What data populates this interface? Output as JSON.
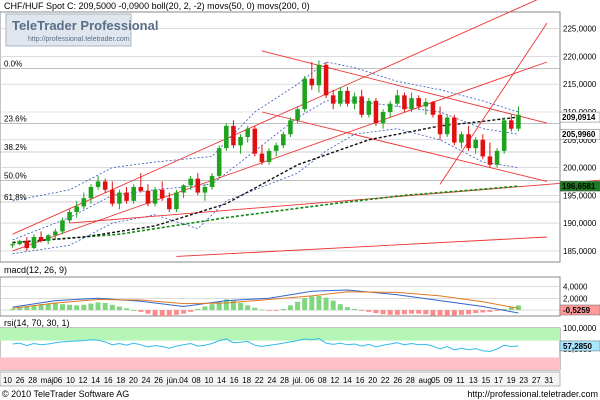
{
  "chart_data": [
    {
      "type": "candlestick",
      "title": "CHF/HUF Spot C: 209,5000 -0,0900 boll(20, 2, -2) movs(50, 0) movs(200, 0)",
      "watermark": {
        "brand": "TeleTrader Professional",
        "url": "http://professional.teletrader.com"
      },
      "ylim": [
        183,
        228
      ],
      "y_ticks": [
        "185,0000",
        "190,0000",
        "195,0000",
        "200,0000",
        "205,0000",
        "210,0000",
        "215,0000",
        "220,0000",
        "225,0000"
      ],
      "fib_levels": [
        {
          "label": "0.0%",
          "y": 217.8
        },
        {
          "label": "23.6%",
          "y": 207.9
        },
        {
          "label": "38.2%",
          "y": 202.8
        },
        {
          "label": "50.0%",
          "y": 197.7
        },
        {
          "label": "61.8%",
          "y": 193.8
        }
      ],
      "value_labels": [
        {
          "text": "209,0914",
          "y": 209.09,
          "color": "#cc0000",
          "bg": "#ffffff"
        },
        {
          "text": "205,9960",
          "y": 206.0,
          "color": "#000000",
          "bg": "#ffffff"
        },
        {
          "text": "196,6581",
          "y": 196.66,
          "color": "#ffffff",
          "bg": "#1f7a1f"
        }
      ],
      "candles": [
        [
          186.0,
          186.5,
          185.5,
          186.2
        ],
        [
          186.2,
          187.0,
          186.0,
          186.8
        ],
        [
          186.8,
          187.5,
          185.0,
          185.5
        ],
        [
          185.5,
          188.0,
          185.3,
          187.5
        ],
        [
          187.5,
          188.5,
          186.5,
          186.8
        ],
        [
          186.8,
          188.0,
          186.2,
          187.8
        ],
        [
          187.8,
          189.0,
          187.0,
          188.5
        ],
        [
          188.5,
          191.0,
          188.0,
          190.5
        ],
        [
          190.5,
          192.5,
          190.0,
          192.0
        ],
        [
          192.0,
          194.0,
          191.0,
          193.0
        ],
        [
          193.0,
          195.5,
          192.5,
          194.5
        ],
        [
          194.5,
          197.0,
          193.5,
          196.5
        ],
        [
          196.5,
          198.5,
          196.0,
          197.5
        ],
        [
          197.5,
          198.0,
          195.5,
          196.0
        ],
        [
          196.0,
          197.5,
          193.0,
          193.5
        ],
        [
          193.5,
          196.0,
          192.5,
          195.5
        ],
        [
          195.5,
          196.5,
          193.5,
          194.0
        ],
        [
          194.0,
          197.0,
          193.5,
          196.5
        ],
        [
          196.5,
          199.0,
          195.5,
          195.8
        ],
        [
          195.8,
          197.0,
          193.0,
          193.5
        ],
        [
          193.5,
          196.5,
          193.0,
          196.0
        ],
        [
          196.0,
          197.5,
          194.0,
          194.5
        ],
        [
          194.5,
          195.5,
          192.0,
          192.5
        ],
        [
          192.5,
          196.0,
          192.0,
          195.5
        ],
        [
          195.5,
          197.0,
          194.5,
          196.8
        ],
        [
          196.8,
          198.5,
          196.0,
          198.0
        ],
        [
          198.0,
          199.0,
          195.0,
          195.5
        ],
        [
          195.5,
          197.0,
          194.0,
          196.5
        ],
        [
          196.5,
          199.0,
          196.0,
          198.5
        ],
        [
          198.5,
          204.0,
          198.0,
          203.5
        ],
        [
          203.5,
          208.0,
          203.0,
          207.5
        ],
        [
          207.5,
          208.5,
          203.5,
          204.0
        ],
        [
          204.0,
          206.0,
          202.5,
          205.5
        ],
        [
          205.5,
          207.5,
          204.5,
          207.0
        ],
        [
          207.0,
          207.5,
          202.0,
          202.5
        ],
        [
          202.5,
          204.0,
          200.5,
          201.0
        ],
        [
          201.0,
          203.5,
          200.5,
          203.0
        ],
        [
          203.0,
          204.5,
          202.0,
          204.0
        ],
        [
          204.0,
          206.5,
          203.5,
          206.0
        ],
        [
          206.0,
          209.0,
          205.5,
          208.5
        ],
        [
          208.5,
          211.0,
          208.0,
          210.5
        ],
        [
          210.5,
          216.5,
          210.0,
          216.0
        ],
        [
          216.0,
          219.0,
          214.0,
          214.8
        ],
        [
          214.8,
          219.3,
          213.5,
          218.5
        ],
        [
          218.5,
          219.0,
          212.5,
          213.0
        ],
        [
          213.0,
          214.0,
          210.5,
          211.5
        ],
        [
          211.5,
          214.5,
          211.0,
          213.8
        ],
        [
          213.8,
          214.5,
          211.0,
          211.5
        ],
        [
          211.5,
          213.5,
          210.5,
          212.8
        ],
        [
          212.8,
          214.0,
          209.0,
          209.5
        ],
        [
          209.5,
          212.5,
          209.0,
          212.0
        ],
        [
          212.0,
          212.5,
          207.5,
          208.0
        ],
        [
          208.0,
          210.5,
          207.0,
          210.0
        ],
        [
          210.0,
          212.0,
          209.0,
          211.5
        ],
        [
          211.5,
          214.0,
          211.0,
          213.0
        ],
        [
          213.0,
          213.5,
          210.0,
          210.5
        ],
        [
          210.5,
          213.5,
          210.0,
          212.5
        ],
        [
          212.5,
          213.0,
          210.5,
          211.0
        ],
        [
          211.0,
          212.5,
          209.5,
          211.8
        ],
        [
          211.8,
          212.0,
          209.0,
          209.5
        ],
        [
          209.5,
          211.0,
          205.0,
          206.0
        ],
        [
          206.0,
          209.5,
          205.5,
          209.0
        ],
        [
          209.0,
          209.5,
          204.0,
          204.5
        ],
        [
          204.5,
          206.5,
          203.5,
          206.0
        ],
        [
          206.0,
          207.5,
          203.0,
          203.5
        ],
        [
          203.5,
          205.5,
          202.5,
          205.0
        ],
        [
          205.0,
          206.0,
          201.5,
          202.0
        ],
        [
          202.0,
          204.5,
          200.0,
          200.5
        ],
        [
          200.5,
          203.5,
          200.0,
          203.0
        ],
        [
          203.0,
          209.0,
          202.5,
          208.5
        ],
        [
          208.5,
          209.5,
          206.5,
          207.0
        ],
        [
          207.0,
          211.0,
          206.5,
          209.5
        ]
      ],
      "bollinger": {
        "upper": [
          [
            0,
            194
          ],
          [
            8,
            196
          ],
          [
            14,
            200
          ],
          [
            20,
            201
          ],
          [
            28,
            202
          ],
          [
            34,
            210
          ],
          [
            40,
            215
          ],
          [
            44,
            219
          ],
          [
            48,
            218
          ],
          [
            54,
            215.5
          ],
          [
            60,
            214
          ],
          [
            66,
            212
          ],
          [
            71,
            210
          ]
        ],
        "middle": [
          [
            0,
            187
          ],
          [
            8,
            191
          ],
          [
            14,
            195
          ],
          [
            20,
            196
          ],
          [
            28,
            197
          ],
          [
            34,
            203
          ],
          [
            40,
            209
          ],
          [
            44,
            212
          ],
          [
            48,
            212
          ],
          [
            54,
            211
          ],
          [
            60,
            210
          ],
          [
            66,
            207
          ],
          [
            71,
            206
          ]
        ],
        "lower": [
          [
            0,
            184.5
          ],
          [
            8,
            186
          ],
          [
            14,
            190
          ],
          [
            20,
            191.5
          ],
          [
            26,
            189
          ],
          [
            30,
            194
          ],
          [
            36,
            197
          ],
          [
            40,
            199
          ],
          [
            44,
            203
          ],
          [
            48,
            206
          ],
          [
            54,
            207
          ],
          [
            60,
            205
          ],
          [
            66,
            201
          ],
          [
            71,
            200
          ]
        ]
      },
      "ma50": [
        [
          0,
          186.5
        ],
        [
          10,
          187.5
        ],
        [
          20,
          189.5
        ],
        [
          30,
          193.5
        ],
        [
          40,
          200.5
        ],
        [
          50,
          205
        ],
        [
          60,
          207.5
        ],
        [
          66,
          208.3
        ],
        [
          71,
          209.1
        ]
      ],
      "ma200": [
        [
          0,
          186.5
        ],
        [
          15,
          188
        ],
        [
          30,
          191
        ],
        [
          45,
          193.5
        ],
        [
          55,
          195
        ],
        [
          65,
          196
        ],
        [
          71,
          196.66
        ]
      ],
      "trend_lines": [
        {
          "from": [
            0,
            188
          ],
          "to": [
            75,
            231
          ]
        },
        {
          "from": [
            0,
            185
          ],
          "to": [
            75,
            219
          ]
        },
        {
          "from": [
            8,
            190
          ],
          "to": [
            85,
            198
          ]
        },
        {
          "from": [
            35,
            221
          ],
          "to": [
            75,
            208
          ]
        },
        {
          "from": [
            35,
            210
          ],
          "to": [
            75,
            197.5
          ]
        },
        {
          "from": [
            23,
            184
          ],
          "to": [
            75,
            187.5
          ]
        },
        {
          "from": [
            60,
            197
          ],
          "to": [
            75,
            226
          ]
        }
      ]
    },
    {
      "type": "macd",
      "label": "macd(12, 26, 9)",
      "ylim": [
        -1,
        5.6
      ],
      "y_ticks": [
        "4,0000",
        "2,0000",
        "0,0000"
      ],
      "value_label": {
        "text": "-0,5259",
        "bg": "#ff9a9a"
      },
      "hist": [
        0.2,
        0.4,
        0.6,
        0.8,
        1.0,
        1.1,
        1.2,
        1.0,
        0.9,
        0.8,
        0.9,
        1.1,
        1.3,
        1.2,
        0.9,
        0.6,
        0.3,
        0.0,
        -0.3,
        -0.6,
        -0.9,
        -1.0,
        -1.0,
        -0.8,
        -0.6,
        -0.3,
        0.2,
        0.6,
        1.0,
        1.4,
        1.8,
        1.6,
        1.2,
        0.8,
        0.4,
        0.1,
        -0.1,
        -0.1,
        0.2,
        0.8,
        1.4,
        2.0,
        2.3,
        2.4,
        2.1,
        1.6,
        1.0,
        0.5,
        0.2,
        -0.1,
        -0.3,
        -0.5,
        -0.7,
        -0.8,
        -0.8,
        -0.7,
        -0.6,
        -0.6,
        -0.7,
        -0.9,
        -1.0,
        -1.0,
        -0.9,
        -0.8,
        -0.7,
        -0.5,
        -0.4,
        -0.3,
        -0.1,
        0.2,
        0.5,
        0.8
      ],
      "macd_line": [
        [
          0,
          0.5
        ],
        [
          6,
          1.6
        ],
        [
          12,
          2.0
        ],
        [
          18,
          1.5
        ],
        [
          24,
          0.6
        ],
        [
          30,
          1.6
        ],
        [
          36,
          2.0
        ],
        [
          42,
          3.2
        ],
        [
          47,
          3.4
        ],
        [
          54,
          2.6
        ],
        [
          60,
          1.6
        ],
        [
          66,
          0.6
        ],
        [
          71,
          -0.5
        ]
      ],
      "signal_line": [
        [
          0,
          0.3
        ],
        [
          6,
          1.2
        ],
        [
          12,
          1.8
        ],
        [
          18,
          1.7
        ],
        [
          24,
          1.1
        ],
        [
          30,
          1.2
        ],
        [
          36,
          1.8
        ],
        [
          42,
          2.4
        ],
        [
          47,
          3.1
        ],
        [
          54,
          3.0
        ],
        [
          60,
          2.4
        ],
        [
          66,
          1.4
        ],
        [
          71,
          0.3
        ]
      ]
    },
    {
      "type": "line",
      "label": "rsi(14, 70, 30, 1)",
      "ylim": [
        0,
        100
      ],
      "y_ticks": [
        "100,0000",
        "50,0000"
      ],
      "value_label": {
        "text": "57,2850",
        "bg": "#a8e6ff"
      },
      "overbought": 70,
      "oversold": 30,
      "values": [
        62,
        64,
        58,
        63,
        60,
        62,
        65,
        67,
        68,
        69,
        70,
        72,
        71,
        67,
        60,
        63,
        59,
        64,
        60,
        55,
        58,
        56,
        52,
        57,
        60,
        63,
        57,
        59,
        63,
        70,
        74,
        65,
        66,
        68,
        59,
        56,
        59,
        61,
        64,
        67,
        70,
        74,
        72,
        75,
        64,
        61,
        64,
        60,
        62,
        57,
        61,
        55,
        59,
        62,
        65,
        60,
        63,
        60,
        61,
        57,
        50,
        56,
        48,
        52,
        48,
        51,
        46,
        44,
        50,
        59,
        56,
        57.3
      ]
    }
  ],
  "x_labels": [
    "10",
    "26",
    "28",
    "máj.",
    "06",
    "10",
    "12",
    "14",
    "16",
    "18",
    "20",
    "24",
    "26",
    "jún.",
    "04",
    "08",
    "10",
    "14",
    "16",
    "18",
    "22",
    "24",
    "28",
    "júl.",
    "06",
    "08",
    "12",
    "14",
    "16",
    "20",
    "22",
    "26",
    "28",
    "aug.",
    "05",
    "09",
    "11",
    "13",
    "15",
    "17",
    "19",
    "23",
    "27",
    "31"
  ],
  "copyright": "© 2010 TeleTrader Software AG",
  "footer_url": "http://professional.teletrader.com",
  "colors": {
    "up": "#1fa31f",
    "down": "#e01010",
    "bollinger": "#3355bb",
    "ma50": "#111111",
    "ma200": "#118811",
    "trend": "#ee3333",
    "rsi_band_green": "#b5f5b5",
    "rsi_band_red": "#ffc0c8",
    "grid": "#c8c8c8"
  }
}
